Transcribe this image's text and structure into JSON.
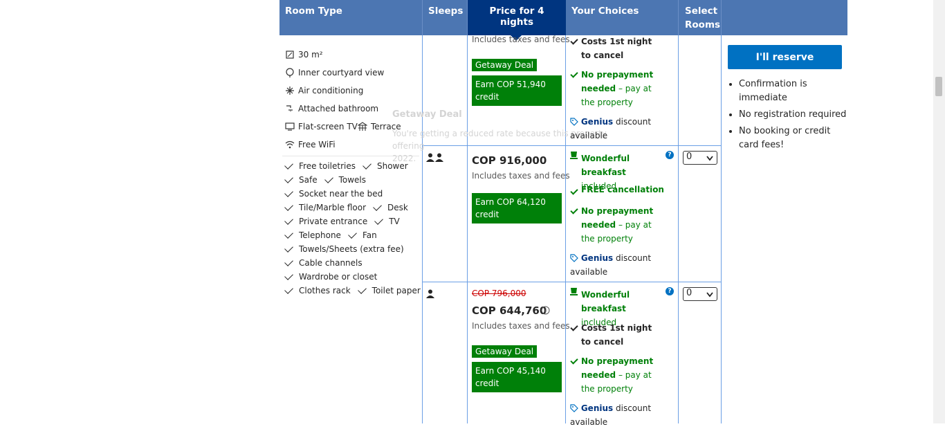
{
  "header": {
    "room_type": "Room Type",
    "sleeps": "Sleeps",
    "price": "Price for 4 nights",
    "choices": "Your Choices",
    "select_line1": "Select",
    "select_line2": "Rooms"
  },
  "room": {
    "size": "30 m²",
    "view": "Inner courtyard view",
    "ac": "Air conditioning",
    "bathroom": "Attached bathroom",
    "tv": "Flat-screen TV",
    "terrace": "Terrace",
    "wifi": "Free WiFi",
    "amenities": [
      [
        "Free toiletries",
        "Shower"
      ],
      [
        "Safe",
        "Towels"
      ],
      [
        "Socket near the bed"
      ],
      [
        "Tile/Marble floor",
        "Desk"
      ],
      [
        "Private entrance",
        "TV"
      ],
      [
        "Telephone",
        "Fan"
      ],
      [
        "Towels/Sheets (extra fee)"
      ],
      [
        "Cable channels"
      ],
      [
        "Wardrobe or closet"
      ],
      [
        "Clothes rack",
        "Toilet paper"
      ]
    ]
  },
  "ghost": {
    "title": "Getaway Deal",
    "line1": "You're getting a reduced rate because this property",
    "line2": "offering",
    "line3": "2022."
  },
  "option1": {
    "includes": "Includes taxes and fees",
    "deal": "Getaway Deal",
    "credit": "Earn COP 51,940 credit",
    "choice1": "Costs 1st night to cancel",
    "prepay_bold": "No prepayment needed",
    "prepay_rest": "– pay at the property",
    "genius": "Genius",
    "genius_rest": "discount available"
  },
  "option2": {
    "price": "COP 916,000",
    "includes": "Includes taxes and fees",
    "credit": "Earn COP 64,120 credit",
    "breakfast": "Wonderful breakfast",
    "included": "included",
    "cancel": "FREE cancellation",
    "prepay_bold": "No prepayment needed",
    "prepay_rest": "– pay at the property",
    "genius": "Genius",
    "genius_rest": "discount available",
    "select_value": "0"
  },
  "option3": {
    "old_price": "COP 796,000",
    "price": "COP 644,760",
    "includes": "Includes taxes and fees",
    "deal": "Getaway Deal",
    "credit": "Earn COP 45,140 credit",
    "breakfast": "Wonderful breakfast",
    "included": "included",
    "choice1": "Costs 1st night to cancel",
    "prepay_bold": "No prepayment needed",
    "prepay_rest": "– pay at the property",
    "genius": "Genius",
    "genius_rest": "discount available",
    "select_value": "0"
  },
  "reserve": {
    "button": "I'll reserve",
    "bullets": [
      "Confirmation is immediate",
      "No registration required",
      "No booking or credit card fees!"
    ]
  }
}
